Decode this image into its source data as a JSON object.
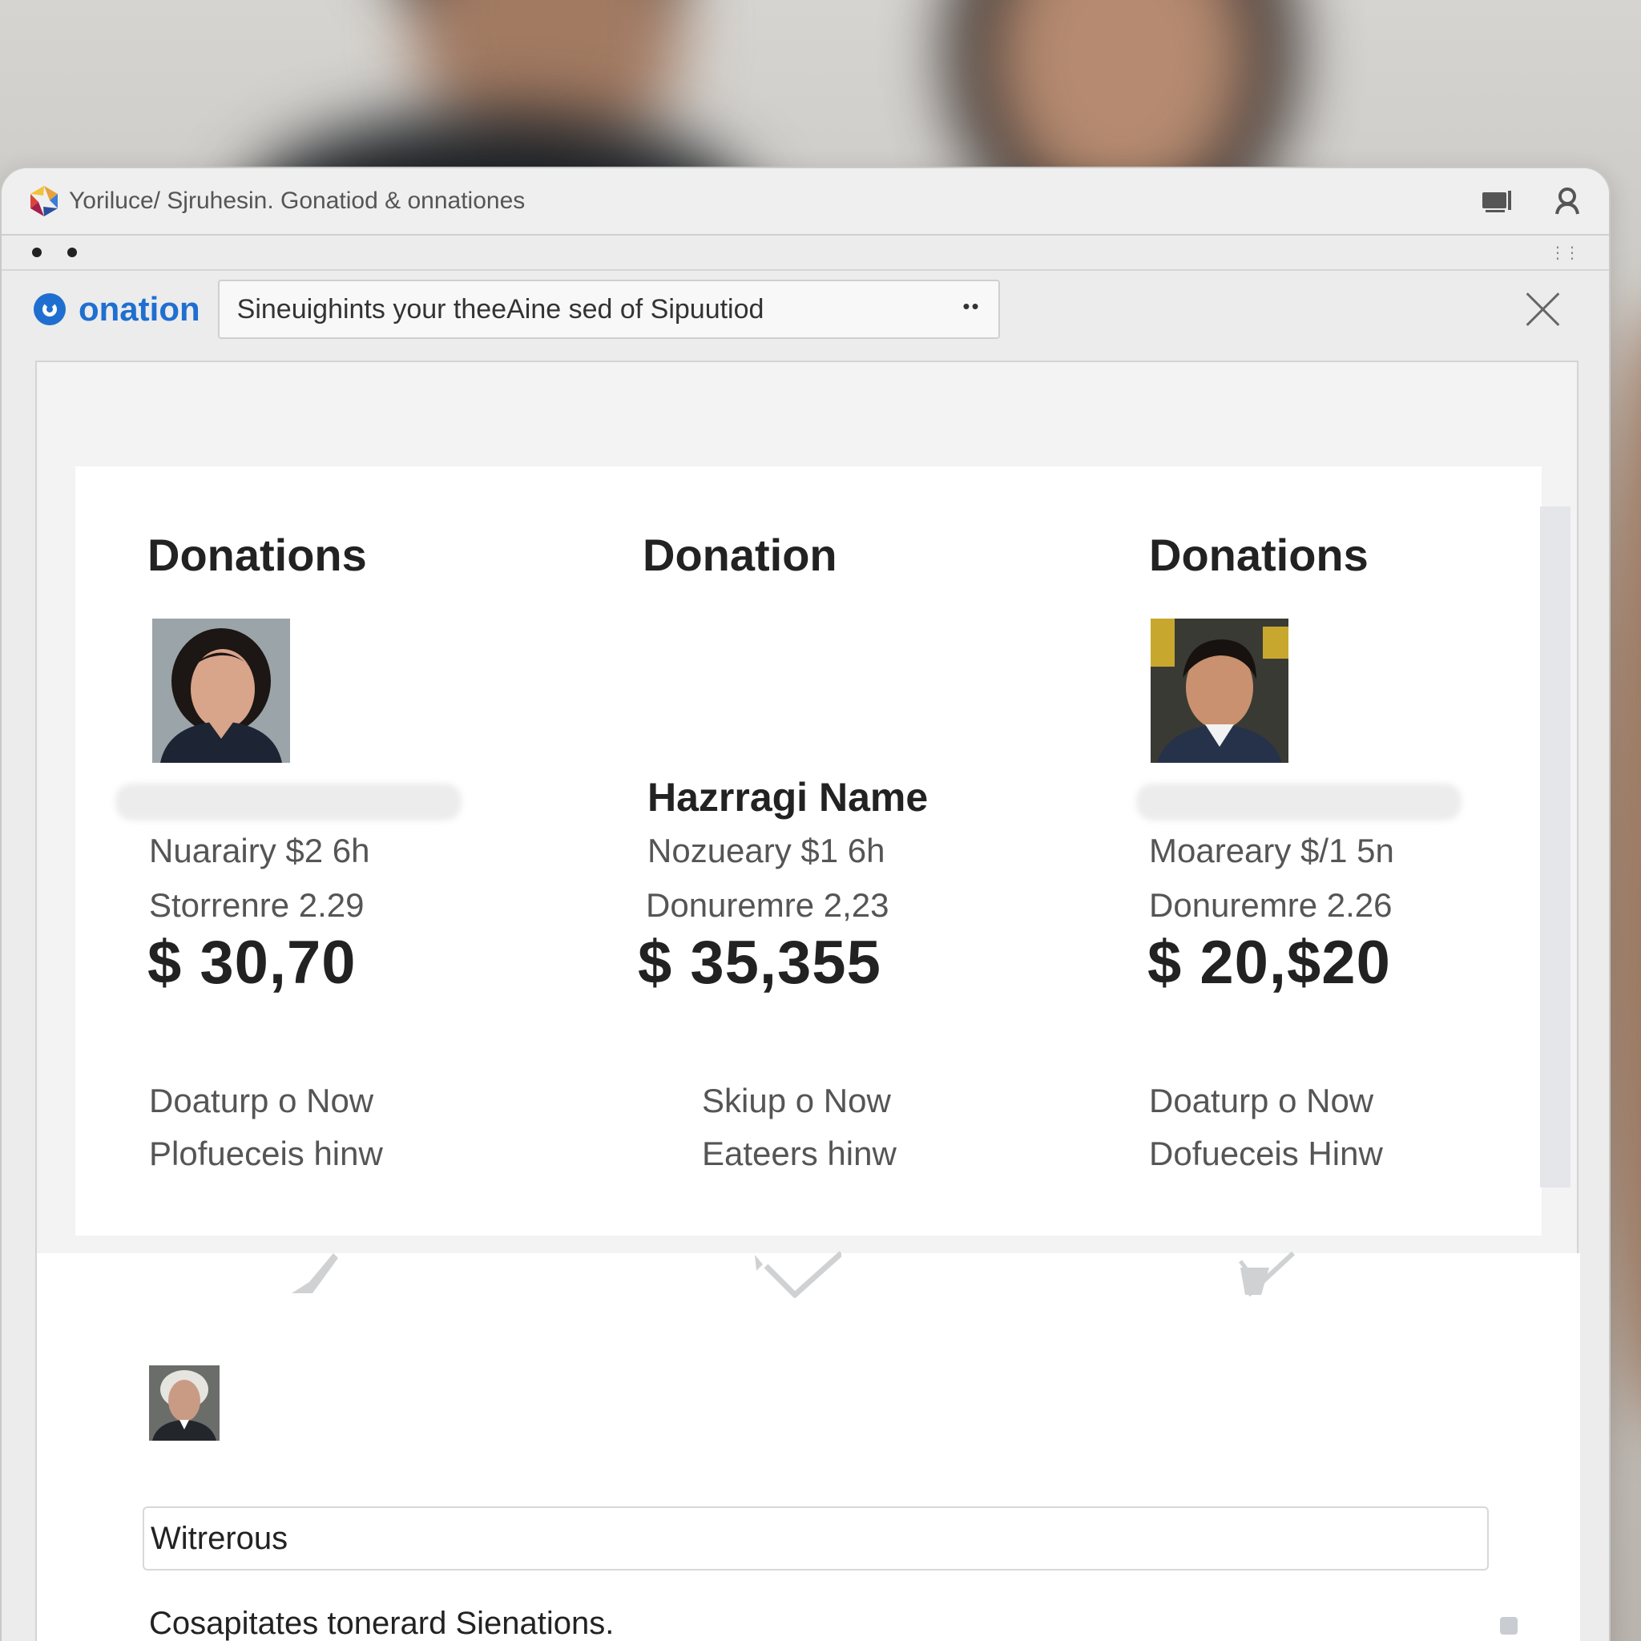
{
  "window": {
    "title": "Yoriluce/ Sjruhesin. Gonatiod & onnationes"
  },
  "search": {
    "brand": "onation",
    "value": "Sineuighints your theeAine sed of Sipuutiod",
    "more": "••"
  },
  "cards": [
    {
      "heading": "Donations",
      "name": "",
      "line1": "Nuarairy $2 6h",
      "line2": "Storrenre 2.29",
      "amount": "$ 30,70",
      "action1": "Doaturp o Now",
      "action2": "Plofueceis hinw"
    },
    {
      "heading": "Donation",
      "name": "Hazrragi Name",
      "line1": "Nozueary $1 6h",
      "line2": "Donuremre 2,23",
      "amount": "$ 35,355",
      "action1": "Skiup o Now",
      "action2": "Eateers hinw"
    },
    {
      "heading": "Donations",
      "name": "",
      "line1": "Moareary $/1 5n",
      "line2": "Donuremre 2.26",
      "amount": "$ 20,$20",
      "action1": "Doaturp o Now",
      "action2": "Dofueceis Hinw"
    }
  ],
  "note": {
    "value": "Witrerous"
  },
  "footer": {
    "text": "Cosapitates tonerard Sienations."
  },
  "colors": {
    "accent": "#1f6fd0",
    "text": "#222222",
    "muted": "#555555"
  }
}
